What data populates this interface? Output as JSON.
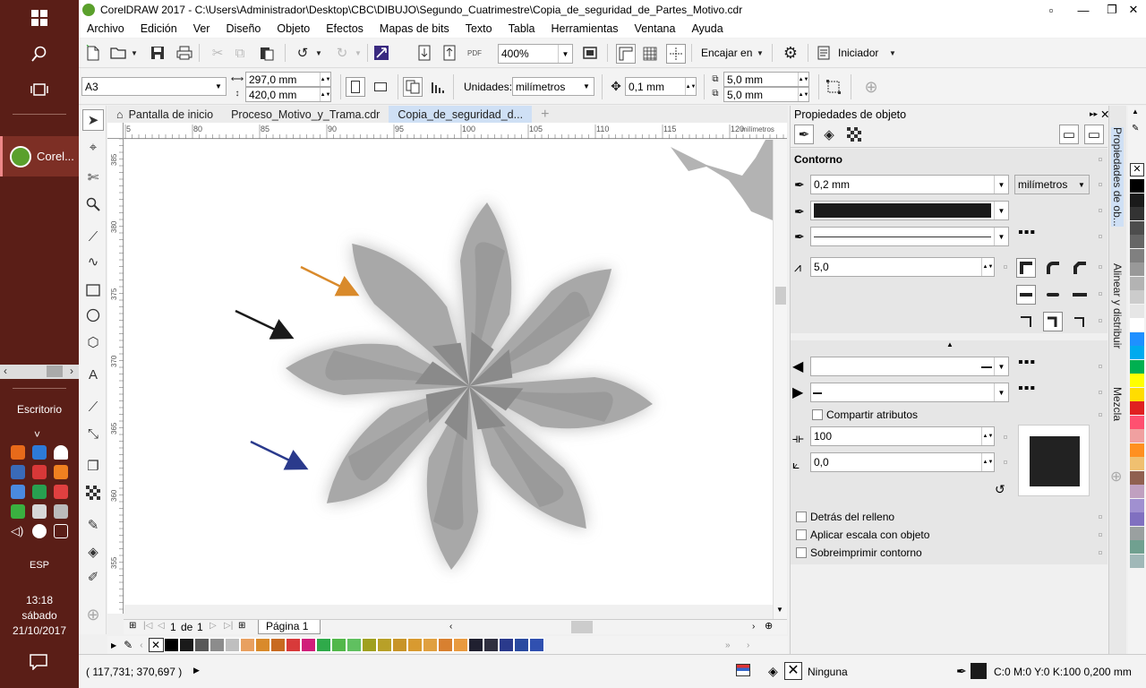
{
  "taskbar": {
    "app_label": "Corel...",
    "scroll_left": "‹",
    "scroll_right": "›",
    "desktop_label": "Escritorio",
    "chevron": "˅",
    "lang": "ESP",
    "time": "13:18",
    "day": "sábado",
    "date": "21/10/2017"
  },
  "window": {
    "title": "CorelDRAW 2017 - C:\\Users\\Administrador\\Desktop\\CBC\\DIBUJO\\Segundo_Cuatrimestre\\Copia_de_seguridad_de_Partes_Motivo.cdr"
  },
  "menu": [
    "Archivo",
    "Edición",
    "Ver",
    "Diseño",
    "Objeto",
    "Efectos",
    "Mapas de bits",
    "Texto",
    "Tabla",
    "Herramientas",
    "Ventana",
    "Ayuda"
  ],
  "toolbar": {
    "zoom": "400%",
    "snap_label": "Encajar en",
    "launcher": "Iniciador"
  },
  "propbar": {
    "page_size": "A3",
    "width": "297,0 mm",
    "height": "420,0 mm",
    "units_label": "Unidades:",
    "units": "milímetros",
    "nudge": "0,1 mm",
    "dup_x": "5,0 mm",
    "dup_y": "5,0 mm"
  },
  "tabs": [
    "Pantalla de inicio",
    "Proceso_Motivo_y_Trama.cdr",
    "Copia_de_seguridad_d..."
  ],
  "ruler": {
    "h": [
      "5",
      "80",
      "85",
      "90",
      "95",
      "100",
      "105",
      "110",
      "115",
      "120"
    ],
    "h_unit": "milímetros",
    "v": [
      "385",
      "380",
      "375",
      "370",
      "365",
      "360",
      "355"
    ]
  },
  "pagenav": {
    "current": "1",
    "of": "de",
    "total": "1",
    "page_tab": "Página 1"
  },
  "status": {
    "coords": "( 117,731; 370,697 )",
    "fill": "Ninguna",
    "outline": "C:0 M:0 Y:0 K:100  0,200 mm"
  },
  "docker": {
    "title": "Propiedades de objeto",
    "section": "Contorno",
    "width": "0,2 mm",
    "units": "milímetros",
    "miter": "5,0",
    "share_attrs": "Compartir atributos",
    "stretch": "100",
    "angle": "0,0",
    "behind_fill": "Detrás del relleno",
    "scale_with": "Aplicar escala con objeto",
    "overprint": "Sobreimprimir contorno"
  },
  "sidetabs": [
    "Propiedades de ob...",
    "Alinear y distribuir",
    "Mezcla"
  ],
  "colors": {
    "accent": "#cfe0f5",
    "taskbar": "#5a1e17",
    "arrow_orange": "#d98a2b",
    "arrow_black": "#1a1a1a",
    "arrow_blue": "#2a3a8c",
    "shape_gray": "#a6a6a6"
  },
  "palette_bottom": [
    "#000000",
    "#1a1a1a",
    "#595959",
    "#8c8c8c",
    "#bfbfbf",
    "#e8a060",
    "#d98a2b",
    "#c86a20",
    "#d83a3a",
    "#d01e7a",
    "#2faa4a",
    "#52b84a",
    "#60c060",
    "#a0a020",
    "#b8a028",
    "#c89428",
    "#d89a30",
    "#e0a040",
    "#d88030",
    "#e89a40",
    "#202030",
    "#303040",
    "#2a3a8c",
    "#2a4aa0",
    "#3050b0"
  ],
  "palette_right": [
    "#000000",
    "#1a1a1a",
    "#333333",
    "#4d4d4d",
    "#666666",
    "#808080",
    "#999999",
    "#b3b3b3",
    "#cccccc",
    "#e6e6e6",
    "#ffffff",
    "#1e90ff",
    "#00aaee",
    "#00b050",
    "#ffff00",
    "#ffdd00",
    "#e02020",
    "#ff5070",
    "#f0a0a0",
    "#ff9020",
    "#f0c070",
    "#906050",
    "#c0a0c0",
    "#a090d0",
    "#8070c0",
    "#9aa0a0",
    "#70a090",
    "#a0b8b8"
  ]
}
